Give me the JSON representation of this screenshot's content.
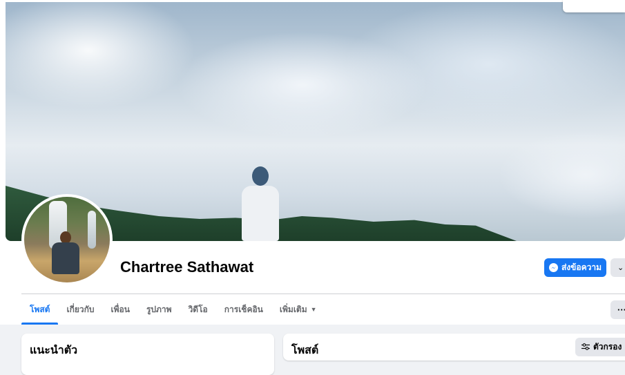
{
  "profile": {
    "name": "Chartree Sathawat",
    "message_button_label": "ส่งข้อความ"
  },
  "tabs": [
    {
      "label": "โพสต์",
      "active": true
    },
    {
      "label": "เกี่ยวกับ",
      "active": false
    },
    {
      "label": "เพื่อน",
      "active": false
    },
    {
      "label": "รูปภาพ",
      "active": false
    },
    {
      "label": "วิดีโอ",
      "active": false
    },
    {
      "label": "การเช็คอิน",
      "active": false
    },
    {
      "label": "เพิ่มเติม",
      "active": false,
      "has_dropdown": true
    }
  ],
  "intro_card": {
    "title": "แนะนำตัว"
  },
  "posts_card": {
    "title": "โพสต์",
    "filter_label": "ตัวกรอง"
  },
  "icons": {
    "messenger": "messenger-icon",
    "chevron": "chevron-down-icon",
    "more": "more-dots-icon",
    "filter": "filter-sliders-icon"
  },
  "colors": {
    "accent": "#1877f2",
    "background": "#f0f2f5",
    "button_gray": "#e4e6eb",
    "text_secondary": "#65676b"
  }
}
